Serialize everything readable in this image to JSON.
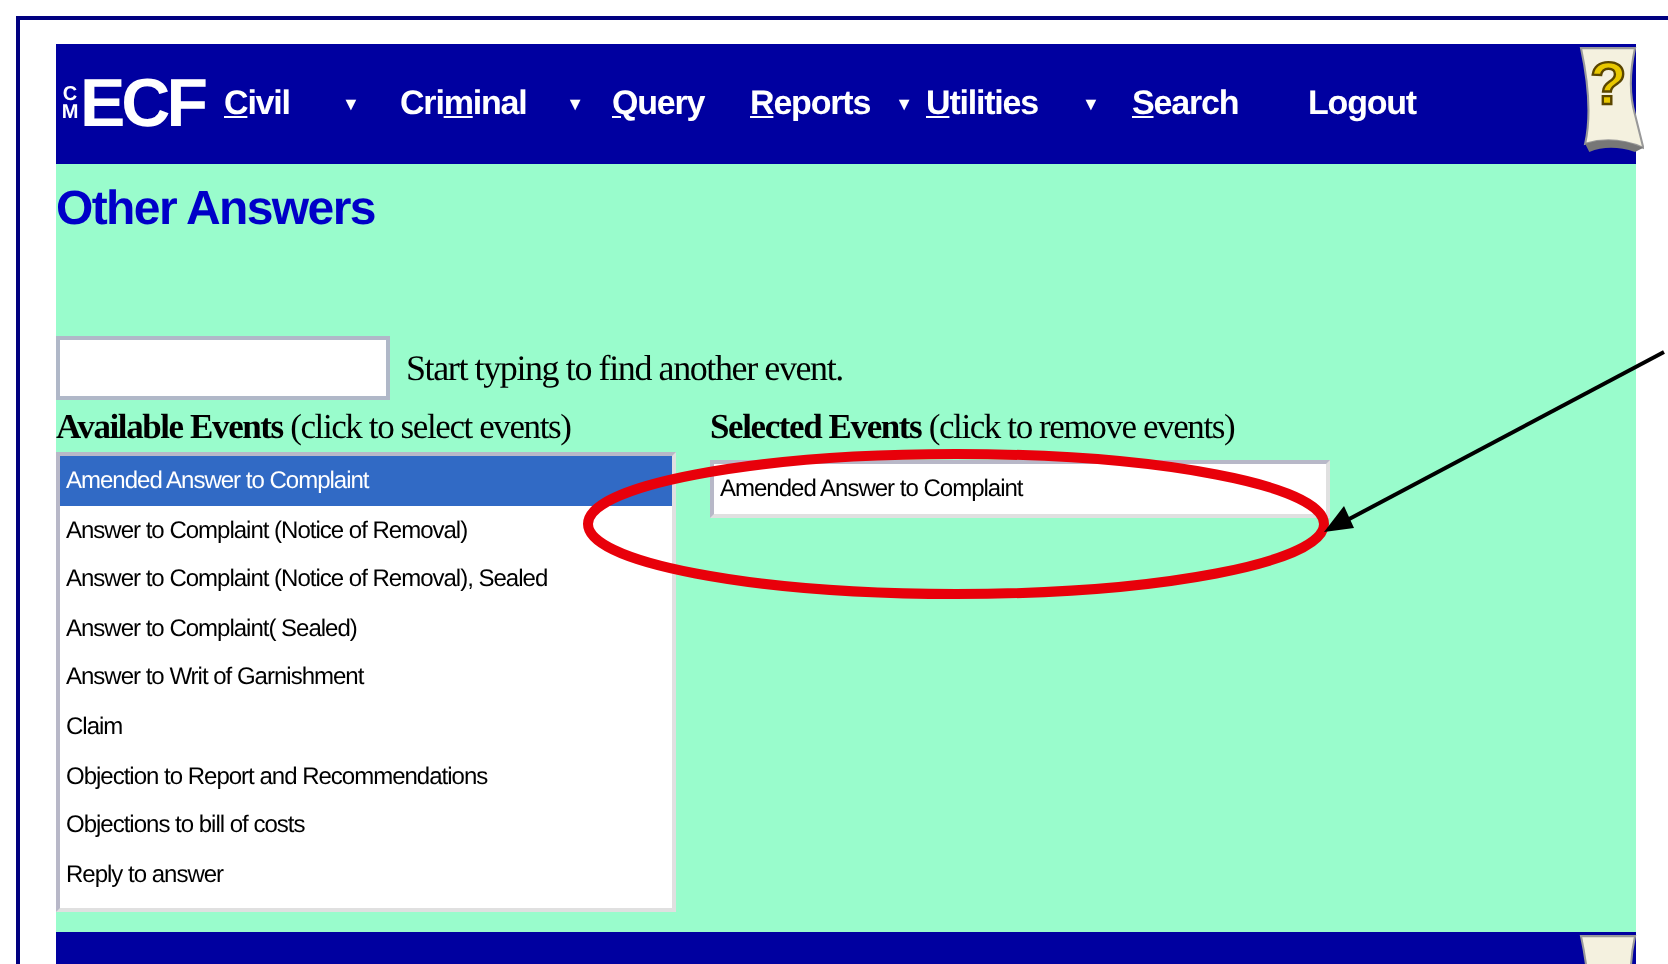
{
  "navbar": {
    "logo": {
      "small": "CM",
      "large": "ECF"
    },
    "menu": [
      {
        "key": "C",
        "after": "ivil",
        "caret": "▼"
      },
      {
        "before": "Cri",
        "key": "m",
        "after": "inal",
        "caret": "▼"
      },
      {
        "key": "Q",
        "after": "uery"
      },
      {
        "key": "R",
        "after": "eports",
        "caret": "▼"
      },
      {
        "key": "U",
        "after": "tilities",
        "caret": "▼"
      },
      {
        "key": "S",
        "after": "earch"
      },
      {
        "before": "Logout"
      }
    ],
    "help_icon": "?"
  },
  "page_title": "Other Answers",
  "event_search": {
    "hint": "Start typing to find another event."
  },
  "available_events": {
    "label": "**Available Events** (click to select events)",
    "items": [
      {
        "label": "Amended Answer to Complaint",
        "selected": true
      },
      {
        "label": "Answer to Complaint (Notice of Removal)",
        "selected": false
      },
      {
        "label": "Answer to Complaint (Notice of Removal), Sealed",
        "selected": false
      },
      {
        "label": "Answer to Complaint( Sealed)",
        "selected": false
      },
      {
        "label": "Answer to Writ of Garnishment",
        "selected": false
      },
      {
        "label": "Claim",
        "selected": false
      },
      {
        "label": "Objection to Report and Recommendations",
        "selected": false
      },
      {
        "label": "Objections to bill of costs",
        "selected": false
      },
      {
        "label": "Reply to answer",
        "selected": false
      }
    ]
  },
  "selected_events": {
    "label": "**Selected Events** (click to remove events)",
    "items": [
      {
        "label": "Amended Answer to Complaint",
        "selected": false
      }
    ]
  },
  "annotation": {
    "highlight_ellipse": true,
    "pointer_arrow": true
  }
}
